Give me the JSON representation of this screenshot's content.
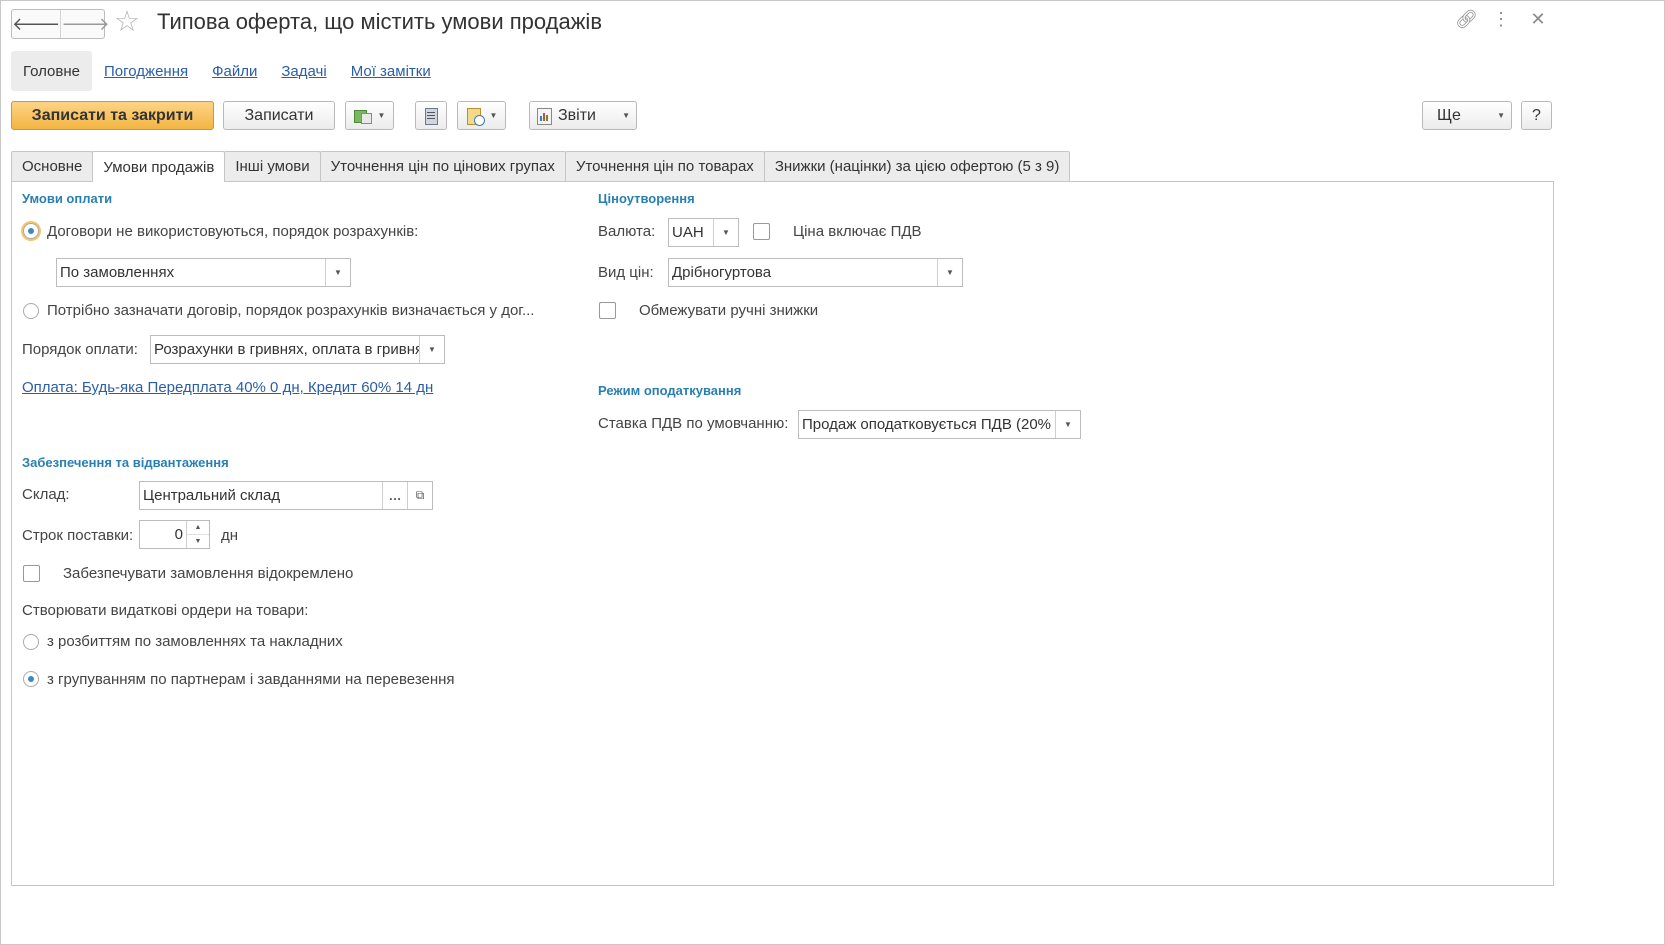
{
  "window": {
    "title": "Типова оферта, що містить умови продажів"
  },
  "main_tabs": [
    "Головне",
    "Погодження",
    "Файли",
    "Задачі",
    "Мої замітки"
  ],
  "toolbar": {
    "save_close": "Записати та закрити",
    "save": "Записати",
    "reports": "Звіти",
    "more": "Ще",
    "help": "?"
  },
  "form_tabs": [
    "Основне",
    "Умови продажів",
    "Інші умови",
    "Уточнення цін по цінових групах",
    "Уточнення цін по товарах",
    "Знижки (націнки) за цією офертою (5 з 9)"
  ],
  "payment": {
    "section": "Умови оплати",
    "radio1": "Договори не використовуються, порядок розрахунків:",
    "radio1_value": "По замовленнях",
    "radio2": "Потрібно зазначати договір, порядок розрахунків визначається у дог...",
    "order_label": "Порядок оплати:",
    "order_value": "Розрахунки в гривнях, оплата в гривнях",
    "terms_link": "Оплата: Будь-яка Передплата 40% 0 дн, Кредит 60% 14 дн"
  },
  "shipping": {
    "section": "Забезпечення та відвантаження",
    "warehouse_label": "Склад:",
    "warehouse_value": "Центральний склад",
    "lead_label": "Строк поставки:",
    "lead_value": "0",
    "lead_unit": "дн",
    "separate": "Забезпечувати замовлення відокремлено",
    "orders_label": "Створювати видаткові ордери на товари:",
    "orders_opt1": "з розбиттям по замовленнях та накладних",
    "orders_opt2": "з групуванням по партнерам і завданнями на перевезення"
  },
  "pricing": {
    "section": "Ціноутворення",
    "currency_label": "Валюта:",
    "currency_value": "UAH",
    "vat_incl": "Ціна включає ПДВ",
    "price_type_label": "Вид цін:",
    "price_type_value": "Дрібногуртова",
    "limit_discounts": "Обмежувати ручні знижки"
  },
  "tax": {
    "section": "Режим оподаткування",
    "rate_label": "Ставка ПДВ по умовчанню:",
    "rate_value": "Продаж оподатковується ПДВ (20%"
  }
}
